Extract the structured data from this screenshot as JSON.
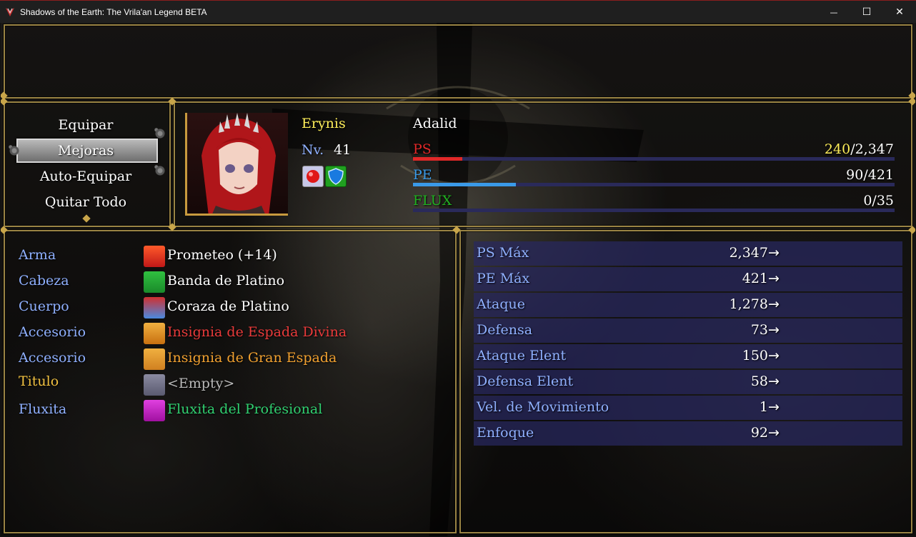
{
  "window": {
    "title": "Shadows of the Earth: The Vrila'an Legend BETA",
    "minimize_glyph": "—",
    "maximize_glyph": "☐",
    "close_glyph": "✕"
  },
  "commands": {
    "items": [
      "Equipar",
      "Mejoras",
      "Auto-Equipar",
      "Quitar Todo"
    ],
    "selected": "Mejoras"
  },
  "actor": {
    "name": "Erynis",
    "level_label": "Nv.",
    "level": "41",
    "class": "Adalid",
    "hp_label": "PS",
    "hp_current": "240",
    "hp_separator": "/",
    "hp_max": "2,347",
    "hp_ratio": 0.102,
    "mp_label": "PE",
    "mp_value": "90/421",
    "mp_ratio": 0.214,
    "flux_label": "FLUX",
    "flux_value": "0/35",
    "flux_ratio": 0,
    "state_icons": [
      "red-orb-icon",
      "blue-shield-icon"
    ]
  },
  "colors": {
    "system_blue": "#8fb0ff",
    "hp_red": "#e02828",
    "mp_blue": "#3a9ae8",
    "flux_green": "#20b020",
    "name_yellow": "#ffef5a",
    "divine_red": "#e83a3a",
    "orange": "#f0a030",
    "green": "#30d070",
    "gray": "#b8b8b8"
  },
  "equipment": [
    {
      "slot": "Arma",
      "item": "Prometeo (+14)",
      "icon": "fire-icon",
      "color": "#ffffff",
      "slot_color": "#8fb0ff"
    },
    {
      "slot": "Cabeza",
      "item": "Banda de Platino",
      "icon": "headband-icon",
      "color": "#ffffff",
      "slot_color": "#8fb0ff"
    },
    {
      "slot": "Cuerpo",
      "item": "Coraza de Platino",
      "icon": "armor-icon",
      "color": "#ffffff",
      "slot_color": "#8fb0ff"
    },
    {
      "slot": "Accesorio",
      "item": "Insignia de Espada Divina",
      "icon": "sword-badge-icon",
      "color": "#e83a3a",
      "slot_color": "#8fb0ff"
    },
    {
      "slot": "Accesorio",
      "item": "Insignia de Gran Espada",
      "icon": "greatsword-badge-icon",
      "color": "#f0a030",
      "slot_color": "#8fb0ff"
    },
    {
      "slot": "Titulo",
      "item": "<Empty>",
      "icon": "empty-slot-icon",
      "color": "#b8b8b8",
      "slot_color": "#f0c040"
    },
    {
      "slot": "Fluxita",
      "item": "Fluxita del Profesional",
      "icon": "crystal-icon",
      "color": "#30d070",
      "slot_color": "#8fb0ff"
    }
  ],
  "stats": [
    {
      "label": "PS Máx",
      "value": "2,347",
      "arrow": "→"
    },
    {
      "label": "PE Máx",
      "value": "421",
      "arrow": "→"
    },
    {
      "label": "Ataque",
      "value": "1,278",
      "arrow": "→"
    },
    {
      "label": "Defensa",
      "value": "73",
      "arrow": "→"
    },
    {
      "label": "Ataque Elent",
      "value": "150",
      "arrow": "→"
    },
    {
      "label": "Defensa Elent",
      "value": "58",
      "arrow": "→"
    },
    {
      "label": "Vel. de Movimiento",
      "value": "1",
      "arrow": "→"
    },
    {
      "label": "Enfoque",
      "value": "92",
      "arrow": "→"
    }
  ]
}
